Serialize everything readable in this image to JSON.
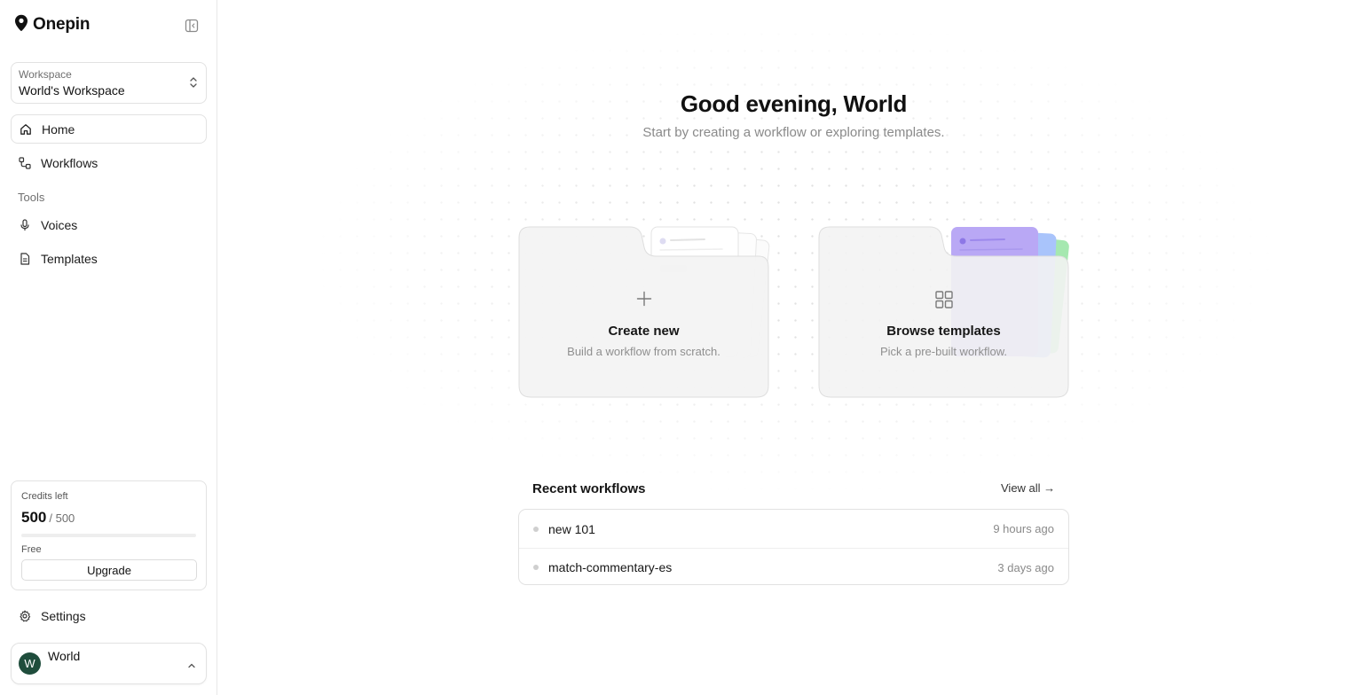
{
  "brand": {
    "name": "Onepin"
  },
  "workspace": {
    "label": "Workspace",
    "name": "World's Workspace"
  },
  "nav": {
    "home": "Home",
    "workflows": "Workflows",
    "tools_label": "Tools",
    "voices": "Voices",
    "templates": "Templates",
    "settings": "Settings"
  },
  "credits": {
    "label": "Credits left",
    "used": "500",
    "total": "/ 500",
    "plan": "Free",
    "upgrade_label": "Upgrade",
    "bar_fraction": 1.0
  },
  "user": {
    "initial": "W",
    "name": "World"
  },
  "main": {
    "greeting": "Good evening, World",
    "subtitle": "Start by creating a workflow or exploring templates.",
    "cards": [
      {
        "title": "Create new",
        "subtitle": "Build a workflow from scratch.",
        "icon": "plus-icon"
      },
      {
        "title": "Browse templates",
        "subtitle": "Pick a pre-built workflow.",
        "icon": "grid-icon"
      }
    ],
    "recent": {
      "title": "Recent workflows",
      "view_all": "View all →",
      "items": [
        {
          "name": "new 101",
          "time": "9 hours ago"
        },
        {
          "name": "match-commentary-es",
          "time": "3 days ago"
        }
      ]
    }
  },
  "colors": {
    "accent_purple": "#b9a8f5",
    "accent_blue": "#a9c4fb",
    "accent_green": "#a5e8b0",
    "avatar": "#1f4d3c",
    "card_bg": "#f3f3f3"
  }
}
